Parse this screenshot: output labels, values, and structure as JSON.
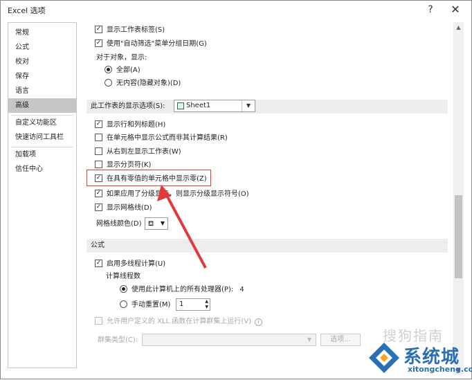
{
  "window": {
    "title": "Excel 选项",
    "help_glyph": "?",
    "close_glyph": "✕"
  },
  "sidebar": {
    "items": [
      {
        "label": "常规"
      },
      {
        "label": "公式"
      },
      {
        "label": "校对"
      },
      {
        "label": "保存"
      },
      {
        "label": "语言"
      },
      {
        "label": "高级",
        "active": true
      },
      {
        "label": "自定义功能区"
      },
      {
        "label": "快速访问工具栏"
      },
      {
        "label": "加载项"
      },
      {
        "label": "信任中心"
      }
    ]
  },
  "workbook_opts": {
    "show_sheet_tabs": {
      "label": "显示工作表标签(S)",
      "checked": true
    },
    "group_dates": {
      "label": "使用\"自动筛选\"菜单分组日期(G)",
      "checked": true
    },
    "objects_label": "对于对象，显示:",
    "radio_all": {
      "label": "全部(A)",
      "selected": true
    },
    "radio_none": {
      "label": "无内容(隐藏对象)(D)",
      "selected": false
    }
  },
  "sheet_section": {
    "label": "此工作表的显示选项(S):",
    "sheet_value": "Sheet1"
  },
  "sheet_opts": {
    "row_col_headers": {
      "label": "显示行和列标题(H)",
      "checked": true
    },
    "show_formulas": {
      "label": "在单元格中显示公式而非其计算结果(R)",
      "checked": false
    },
    "right_to_left": {
      "label": "从右到左显示工作表(W)",
      "checked": false
    },
    "page_breaks": {
      "label": "显示分页符(K)",
      "checked": false
    },
    "show_zero": {
      "label": "在具有零值的单元格中显示零(Z)",
      "checked": true
    },
    "outline_symbols": {
      "label": "如果应用了分级显示，则显示分级显示符号(O)",
      "checked": true
    },
    "gridlines": {
      "label": "显示网格线(D)",
      "checked": true
    },
    "gridline_color_label": "网格线颜色(D)"
  },
  "formulas": {
    "header": "公式",
    "multithread": {
      "label": "启用多线程计算(U)",
      "checked": true
    },
    "threads_label": "计算线程数",
    "use_all": {
      "label": "使用此计算机上的所有处理器(P):",
      "value": "4",
      "selected": true
    },
    "manual": {
      "label": "手动重置(M)",
      "value": "1",
      "selected": false
    },
    "xll": {
      "label": "允许用户定义的 XLL 函数在计算群集上运行(V)",
      "checked": false
    },
    "cluster_label": "群集类型(C):",
    "options_button": "选项..."
  },
  "watermark": {
    "brand": "系统城",
    "url": "xitongcheng.com",
    "faint": "搜狗指南"
  },
  "colors": {
    "highlight": "#e03a3a",
    "accent": "#2a6fb5"
  }
}
